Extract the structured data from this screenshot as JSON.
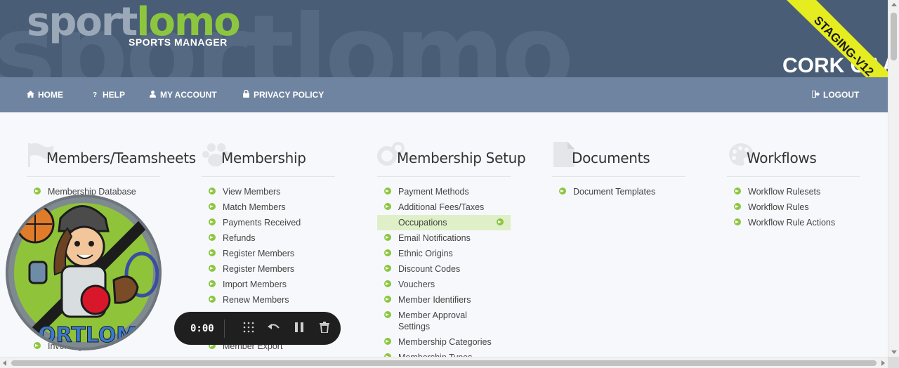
{
  "header": {
    "logo_part1": "sport",
    "logo_part2": "lomo",
    "tagline": "SPORTS MANAGER",
    "org_name": "CORK GAA",
    "staging_label": "STAGING-V12"
  },
  "nav": {
    "home": "HOME",
    "help": "HELP",
    "account": "MY ACCOUNT",
    "privacy": "PRIVACY POLICY",
    "logout": "LOGOUT"
  },
  "columns": [
    {
      "title": "Members/Teamsheets",
      "items": [
        "Membership Database",
        "Invoicing"
      ]
    },
    {
      "title": "Membership",
      "items": [
        "View Members",
        "Match Members",
        "Payments Received",
        "Refunds",
        "Register Members",
        "Register Members",
        "Import Members",
        "Renew Members",
        "Member Export"
      ]
    },
    {
      "title": "Membership Setup",
      "items": [
        "Payment Methods",
        "Additional Fees/Taxes",
        "Occupations",
        "Email Notifications",
        "Ethnic Origins",
        "Discount Codes",
        "Vouchers",
        "Member Identifiers",
        "Member Approval Settings",
        "Membership Categories",
        "Membership Types"
      ]
    },
    {
      "title": "Documents",
      "items": [
        "Document Templates"
      ]
    },
    {
      "title": "Workflows",
      "items": [
        "Workflow Rulesets",
        "Workflow Rules",
        "Workflow Rule Actions"
      ]
    }
  ],
  "recorder": {
    "time": "0:00"
  },
  "mascot": {
    "caption": "ORTLOMO"
  },
  "colors": {
    "banner": "#4a5d76",
    "navbar": "#6f84a0",
    "accent_green": "#8cc63f",
    "staging_yellow": "#e5ec1f"
  }
}
